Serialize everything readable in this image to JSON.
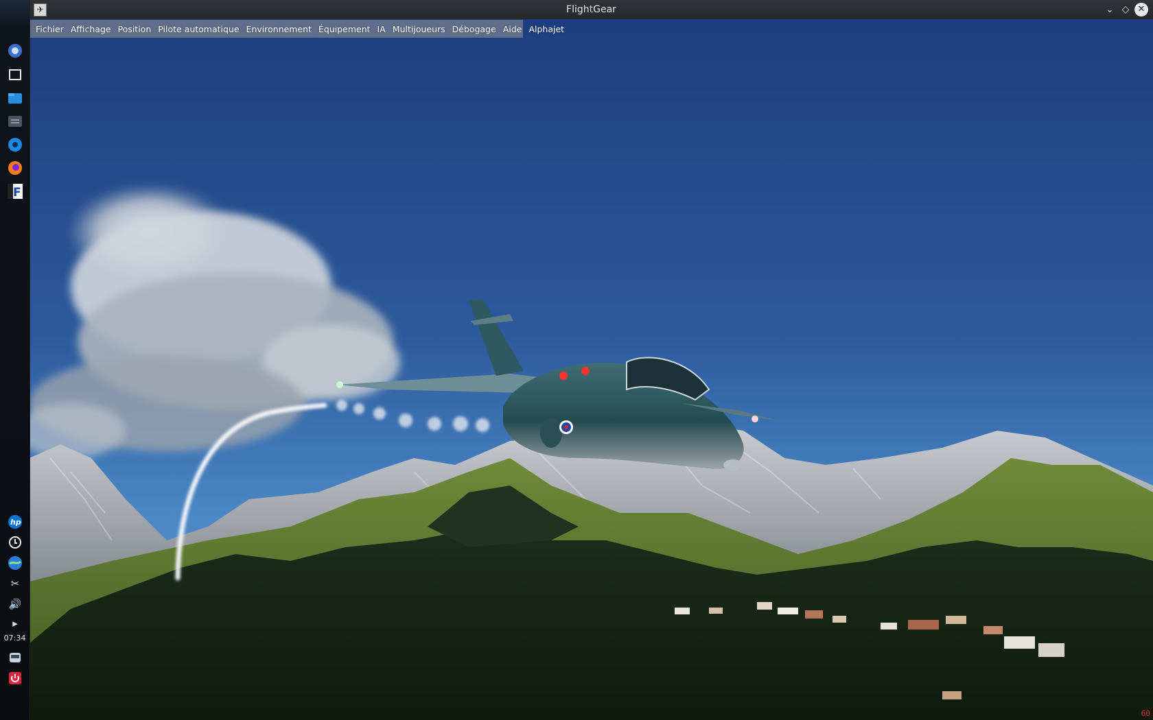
{
  "window": {
    "title": "FlightGear"
  },
  "menubar": {
    "items": [
      {
        "label": "Fichier"
      },
      {
        "label": "Affichage"
      },
      {
        "label": "Position"
      },
      {
        "label": "Pilote automatique"
      },
      {
        "label": "Environnement"
      },
      {
        "label": "Équipement"
      },
      {
        "label": "IA"
      },
      {
        "label": "Multijoueurs"
      },
      {
        "label": "Débogage"
      },
      {
        "label": "Aide"
      },
      {
        "label": "Alphajet"
      }
    ]
  },
  "launcher": {
    "top_icons": [
      "app-menu-icon",
      "desktop-icon",
      "file-manager-icon",
      "settings-panel-icon",
      "system-settings-icon",
      "firefox-icon",
      "flightgear-icon"
    ],
    "bottom_icons": [
      "hp-icon",
      "update-icon",
      "network-icon",
      "scissors-icon",
      "volume-icon",
      "expand-arrow-icon"
    ],
    "clock": "07:34",
    "tray_icons": [
      "drive-icon",
      "power-icon"
    ]
  },
  "status": {
    "fps": "60"
  },
  "colors": {
    "sky_top": "#1e3f7e",
    "sky_bottom": "#4f8cc8",
    "menubar_bg": "#969696",
    "fps_color": "#d83a2a"
  }
}
